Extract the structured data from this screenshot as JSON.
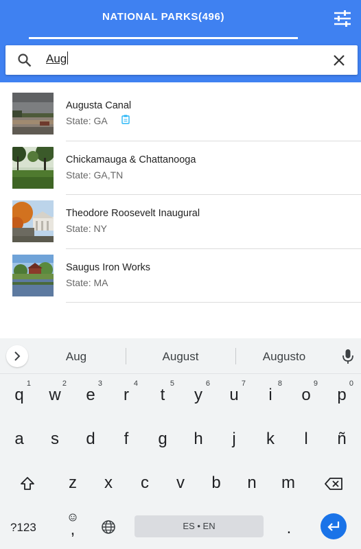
{
  "header": {
    "title": "NATIONAL PARKS(496)",
    "filter_icon": "tune-sliders-icon",
    "color": "#3f81f1"
  },
  "search": {
    "value": "Aug",
    "search_icon": "search-icon",
    "clear_icon": "close-icon"
  },
  "parks": [
    {
      "name": "Augusta Canal",
      "state": "State: GA",
      "has_badge": true,
      "thumb": "canal"
    },
    {
      "name": "Chickamauga & Chattanooga",
      "state": "State: GA,TN",
      "has_badge": false,
      "thumb": "field"
    },
    {
      "name": "Theodore Roosevelt Inaugural",
      "state": "State: NY",
      "has_badge": false,
      "thumb": "house"
    },
    {
      "name": "Saugus Iron Works",
      "state": "State: MA",
      "has_badge": false,
      "thumb": "pond"
    }
  ],
  "keyboard": {
    "suggestions": [
      "Aug",
      "August",
      "Augusto"
    ],
    "row1": [
      "q",
      "w",
      "e",
      "r",
      "t",
      "y",
      "u",
      "i",
      "o",
      "p"
    ],
    "row1_hints": [
      "1",
      "2",
      "3",
      "4",
      "5",
      "6",
      "7",
      "8",
      "9",
      "0"
    ],
    "row2": [
      "a",
      "s",
      "d",
      "f",
      "g",
      "h",
      "j",
      "k",
      "l",
      "ñ"
    ],
    "row3": [
      "z",
      "x",
      "c",
      "v",
      "b",
      "n",
      "m"
    ],
    "num_label": "?123",
    "comma": ",",
    "period": ".",
    "space_label": "ES • EN",
    "accent": "#1a73e8"
  }
}
